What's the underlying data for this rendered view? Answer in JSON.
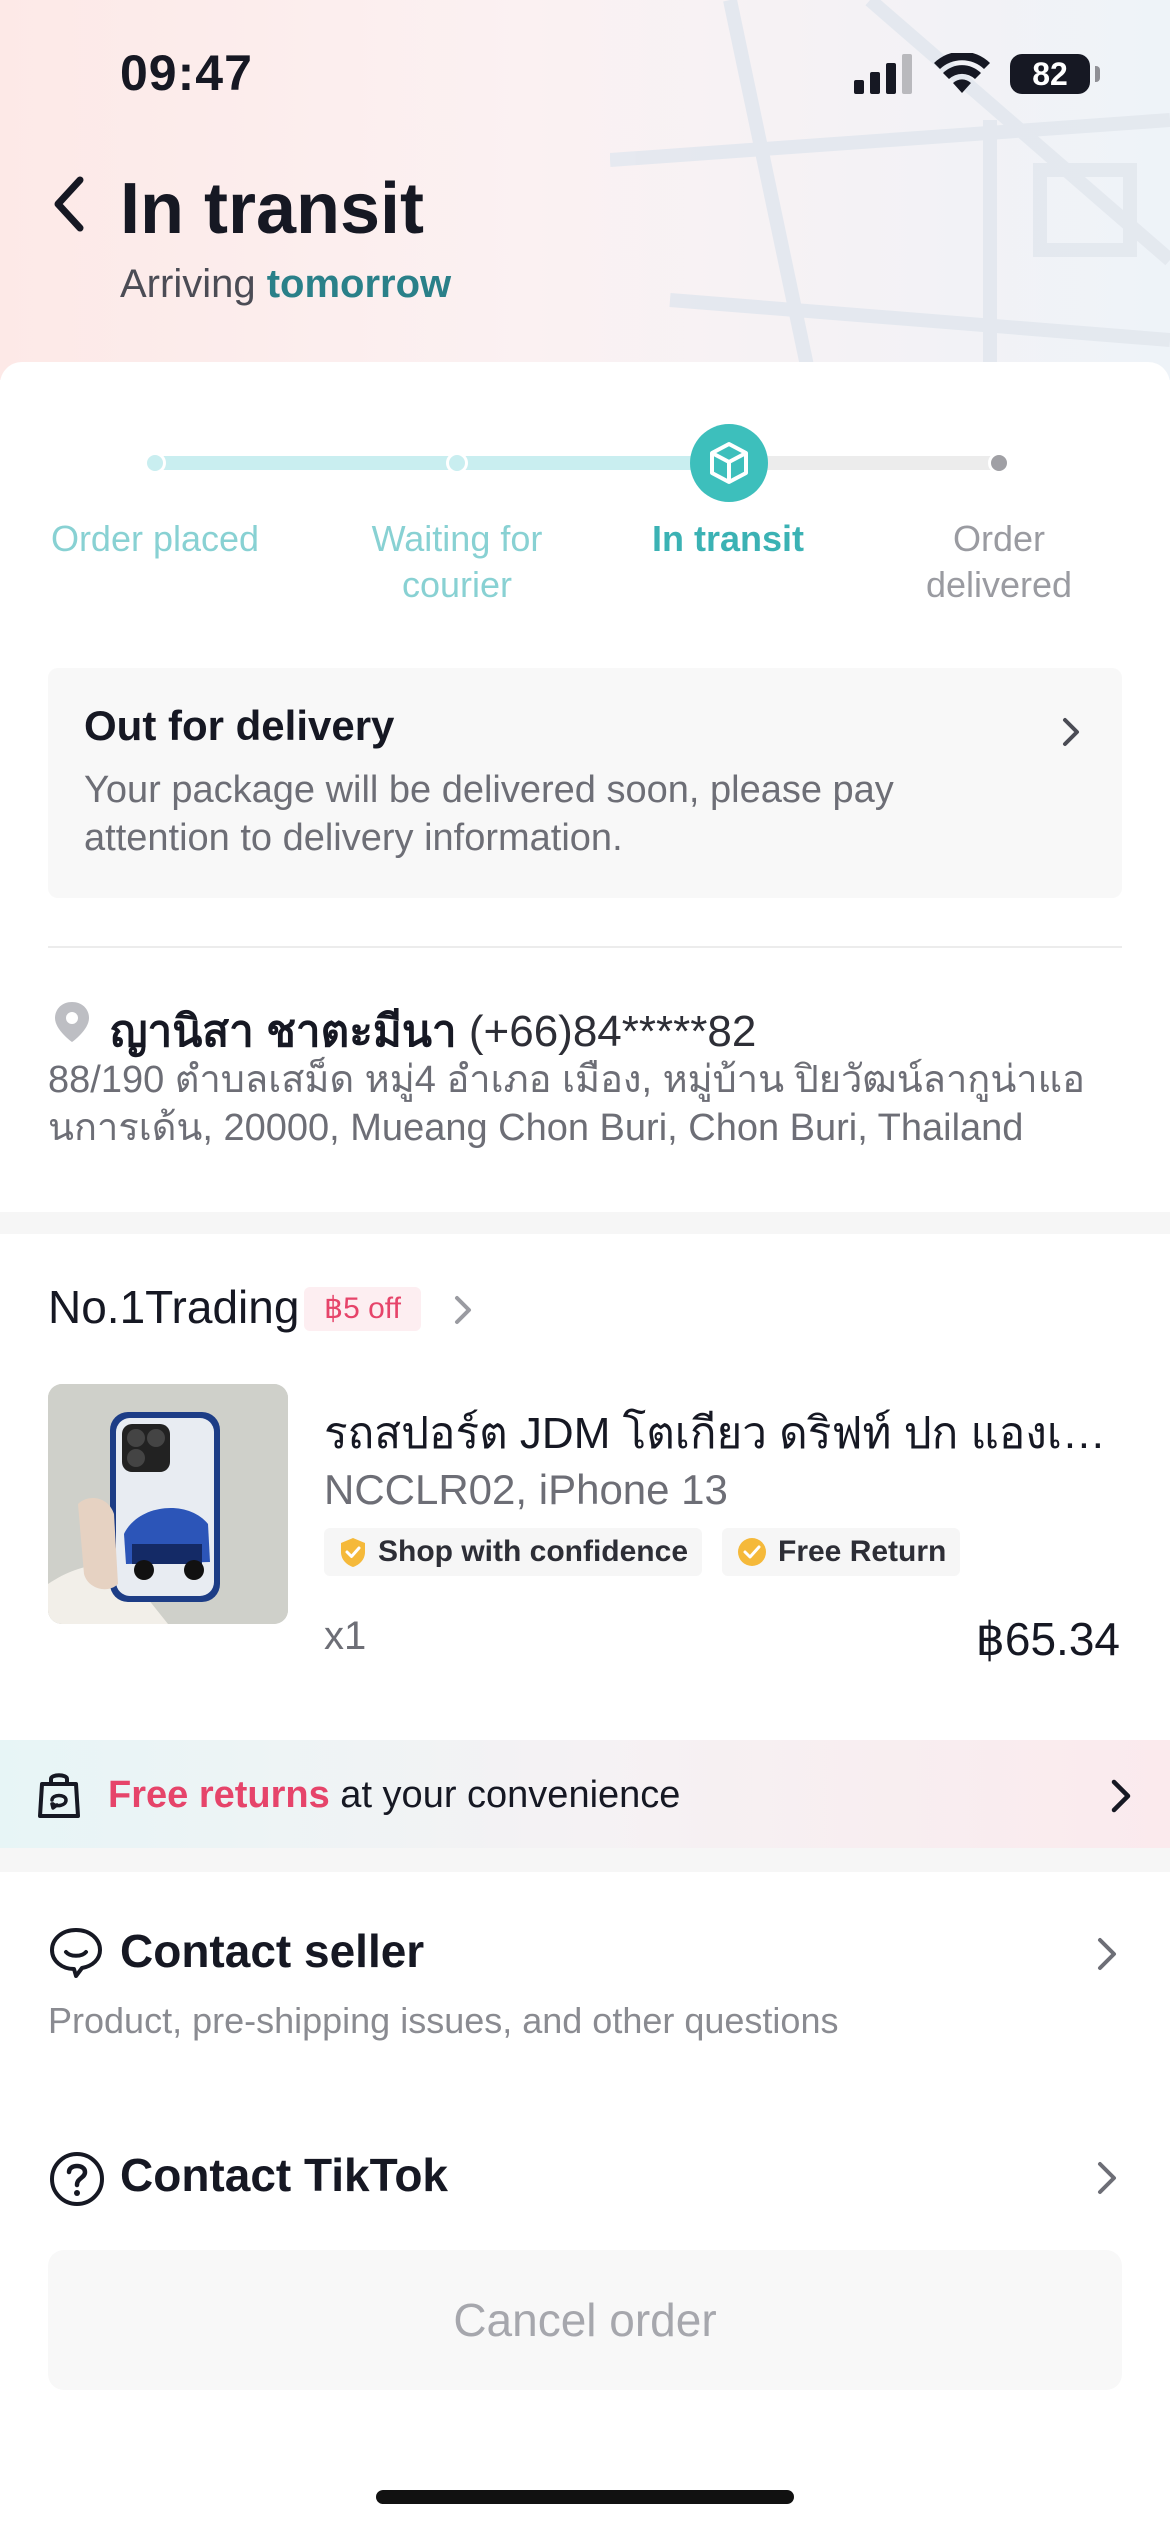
{
  "status_bar": {
    "time": "09:47",
    "battery": "82",
    "icons": [
      "signal-icon",
      "wifi-icon",
      "battery-icon"
    ]
  },
  "header": {
    "title": "In transit",
    "subtitle_prefix": "Arriving",
    "subtitle_accent": "tomorrow"
  },
  "progress": {
    "steps": [
      {
        "label_line1": "Order placed",
        "label_line2": "",
        "state": "done"
      },
      {
        "label_line1": "Waiting for",
        "label_line2": "courier",
        "state": "done"
      },
      {
        "label_line1": "In transit",
        "label_line2": "",
        "state": "current"
      },
      {
        "label_line1": "Order",
        "label_line2": "delivered",
        "state": "todo"
      }
    ]
  },
  "delivery": {
    "title": "Out for delivery",
    "description": "Your package will be delivered soon, please pay attention to delivery information."
  },
  "address": {
    "name": "ญานิสา ชาตะมีนา",
    "phone": "(+66)84*****82",
    "line": "88/190 ตำบลเสม็ด หมู่4 อำเภอ เมือง, หมู่บ้าน ปิยวัฒน์ลากูน่าแอนการเด้น, 20000, Mueang Chon Buri, Chon Buri, Thailand"
  },
  "shop": {
    "name": "No.1Trading",
    "coupon": "฿5 off"
  },
  "product": {
    "title": "รถสปอร์ต JDM โตเกียว ดริฟท์ ปก แองเจิ...",
    "variant": "NCCLR02, iPhone 13",
    "tags": [
      "Shop with confidence",
      "Free Return"
    ],
    "quantity": "x1",
    "price": "฿65.34"
  },
  "returns_banner": {
    "highlight": "Free returns",
    "rest": " at your convenience"
  },
  "contact_seller": {
    "title": "Contact seller",
    "subtitle": "Product, pre-shipping issues, and other questions"
  },
  "contact_tiktok": {
    "title": "Contact TikTok"
  },
  "cancel": {
    "label": "Cancel order"
  },
  "colors": {
    "accent_teal": "#3dbfbc",
    "progress_done": "#c9eef0",
    "returns_red": "#e6446a"
  }
}
